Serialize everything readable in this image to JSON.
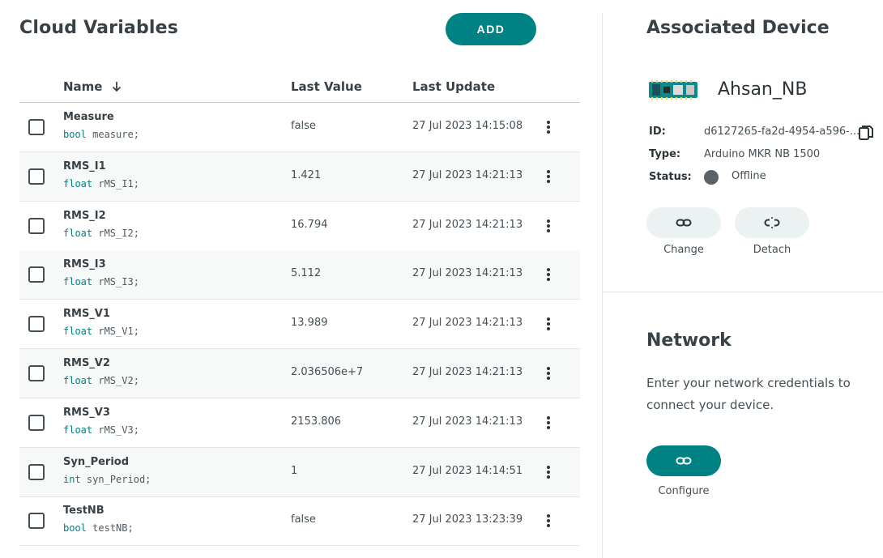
{
  "left": {
    "title": "Cloud Variables",
    "add_label": "ADD",
    "columns": {
      "name": "Name",
      "last_value": "Last Value",
      "last_update": "Last Update"
    }
  },
  "variables": [
    {
      "name": "Measure",
      "type": "bool",
      "decl": "measure;",
      "value": "false",
      "updated": "27 Jul 2023 14:15:08"
    },
    {
      "name": "RMS_I1",
      "type": "float",
      "decl": "rMS_I1;",
      "value": "1.421",
      "updated": "27 Jul 2023 14:21:13"
    },
    {
      "name": "RMS_I2",
      "type": "float",
      "decl": "rMS_I2;",
      "value": "16.794",
      "updated": "27 Jul 2023 14:21:13"
    },
    {
      "name": "RMS_I3",
      "type": "float",
      "decl": "rMS_I3;",
      "value": "5.112",
      "updated": "27 Jul 2023 14:21:13"
    },
    {
      "name": "RMS_V1",
      "type": "float",
      "decl": "rMS_V1;",
      "value": "13.989",
      "updated": "27 Jul 2023 14:21:13"
    },
    {
      "name": "RMS_V2",
      "type": "float",
      "decl": "rMS_V2;",
      "value": "2.036506e+7",
      "updated": "27 Jul 2023 14:21:13"
    },
    {
      "name": "RMS_V3",
      "type": "float",
      "decl": "rMS_V3;",
      "value": "2153.806",
      "updated": "27 Jul 2023 14:21:13"
    },
    {
      "name": "Syn_Period",
      "type": "int",
      "decl": "syn_Period;",
      "value": "1",
      "updated": "27 Jul 2023 14:14:51"
    },
    {
      "name": "TestNB",
      "type": "bool",
      "decl": "testNB;",
      "value": "false",
      "updated": "27 Jul 2023 13:23:39"
    }
  ],
  "device": {
    "section_title": "Associated Device",
    "name": "Ahsan_NB",
    "id_label": "ID:",
    "id_value": "d6127265-fa2d-4954-a596-...",
    "type_label": "Type:",
    "type_value": "Arduino MKR NB 1500",
    "status_label": "Status:",
    "status_value": "Offline",
    "change_label": "Change",
    "detach_label": "Detach"
  },
  "network": {
    "section_title": "Network",
    "description": "Enter your network credentials to connect your device.",
    "configure_label": "Configure"
  },
  "colors": {
    "accent": "#008184",
    "status_offline": "#5a6468"
  },
  "icons": [
    "sort-down-icon",
    "kebab-menu-icon",
    "copy-icon",
    "board-icon",
    "link-icon",
    "unlink-icon"
  ]
}
